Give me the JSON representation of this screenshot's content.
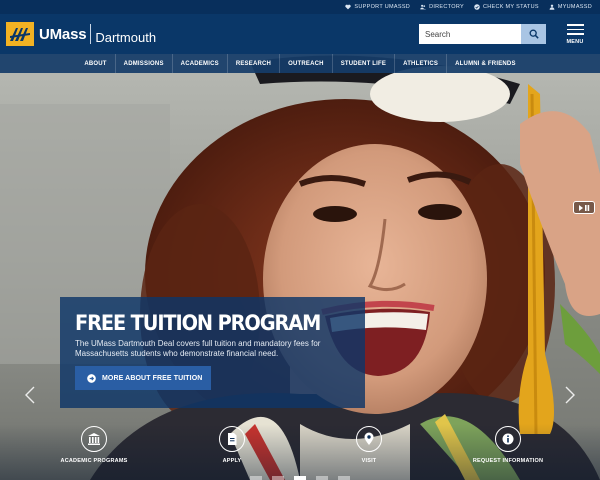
{
  "utility_links": [
    {
      "label": "SUPPORT UMASSD",
      "icon": "heart-icon"
    },
    {
      "label": "DIRECTORY",
      "icon": "people-icon"
    },
    {
      "label": "CHECK MY STATUS",
      "icon": "check-icon"
    },
    {
      "label": "MYUMASSD",
      "icon": "user-icon"
    }
  ],
  "logo": {
    "umass": "UMass",
    "dartmouth": "Dartmouth"
  },
  "search": {
    "placeholder": "Search"
  },
  "menu": {
    "label": "MENU"
  },
  "nav": [
    "ABOUT",
    "ADMISSIONS",
    "ACADEMICS",
    "RESEARCH",
    "OUTREACH",
    "STUDENT LIFE",
    "ATHLETICS",
    "ALUMNI & FRIENDS"
  ],
  "hero": {
    "title": "FREE TUITION PROGRAM",
    "text": "The UMass Dartmouth Deal covers full tuition and mandatory fees for Massachusetts students who demonstrate financial need.",
    "button": "MORE ABOUT FREE TUITION"
  },
  "quick_links": [
    {
      "label": "ACADEMIC PROGRAMS",
      "icon": "building-icon"
    },
    {
      "label": "APPLY",
      "icon": "document-icon"
    },
    {
      "label": "VISIT",
      "icon": "map-pin-icon"
    },
    {
      "label": "REQUEST INFORMATION",
      "icon": "info-icon"
    }
  ],
  "colors": {
    "topbar": "#082f5c",
    "header": "#0a3768",
    "logo_gold": "#f2b223",
    "button_blue": "#2a5ea4"
  }
}
